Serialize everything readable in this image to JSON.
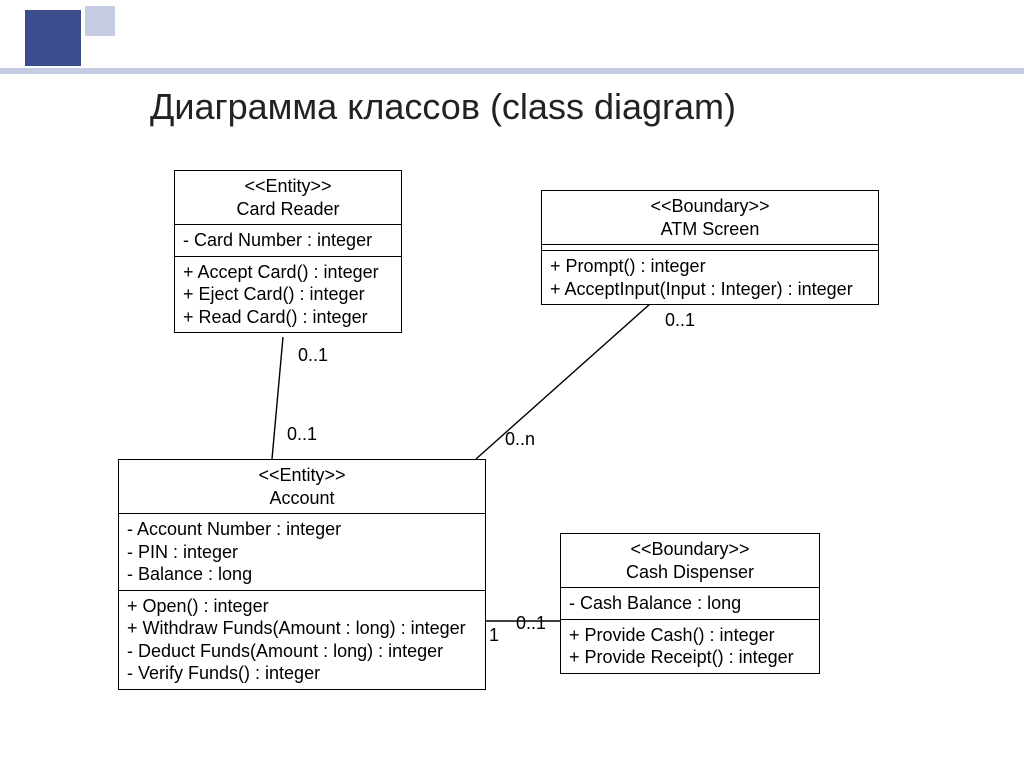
{
  "title": "Диаграмма классов (class diagram)",
  "classes": {
    "cardReader": {
      "stereotype": "<<Entity>>",
      "name": "Card Reader",
      "attrs": [
        "- Card Number : integer"
      ],
      "ops": [
        "+ Accept Card() : integer",
        "+ Eject Card() : integer",
        "+ Read Card() : integer"
      ]
    },
    "atmScreen": {
      "stereotype": "<<Boundary>>",
      "name": "ATM Screen",
      "attrs": [],
      "ops": [
        "+ Prompt() : integer",
        "+ AcceptInput(Input : Integer) : integer"
      ]
    },
    "account": {
      "stereotype": "<<Entity>>",
      "name": "Account",
      "attrs": [
        "- Account Number : integer",
        "- PIN : integer",
        "- Balance : long"
      ],
      "ops": [
        "+ Open() : integer",
        "+ Withdraw Funds(Amount : long) : integer",
        "- Deduct Funds(Amount : long) : integer",
        "- Verify Funds() : integer"
      ]
    },
    "cashDispenser": {
      "stereotype": "<<Boundary>>",
      "name": "Cash Dispenser",
      "attrs": [
        "- Cash Balance : long"
      ],
      "ops": [
        "+ Provide Cash() : integer",
        "+ Provide Receipt() : integer"
      ]
    }
  },
  "associations": [
    {
      "from": "cardReader",
      "to": "account",
      "mult_from": "0..1",
      "mult_to": "0..1"
    },
    {
      "from": "atmScreen",
      "to": "account",
      "mult_from": "0..1",
      "mult_to": "0..n"
    },
    {
      "from": "account",
      "to": "cashDispenser",
      "mult_from": "1",
      "mult_to": "0..1"
    }
  ]
}
